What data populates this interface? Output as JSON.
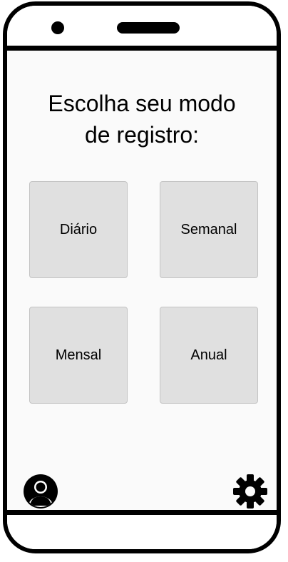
{
  "screen": {
    "title_line1": "Escolha seu modo",
    "title_line2": "de registro:"
  },
  "modes": [
    {
      "label": "Diário"
    },
    {
      "label": "Semanal"
    },
    {
      "label": "Mensal"
    },
    {
      "label": "Anual"
    }
  ],
  "footer": {
    "profile_icon": "user-avatar-icon",
    "settings_icon": "gear-icon"
  },
  "colors": {
    "frame": "#000000",
    "screen_bg": "#fafafa",
    "button_bg": "#e0e0e0",
    "button_border": "#c4c4c4"
  }
}
